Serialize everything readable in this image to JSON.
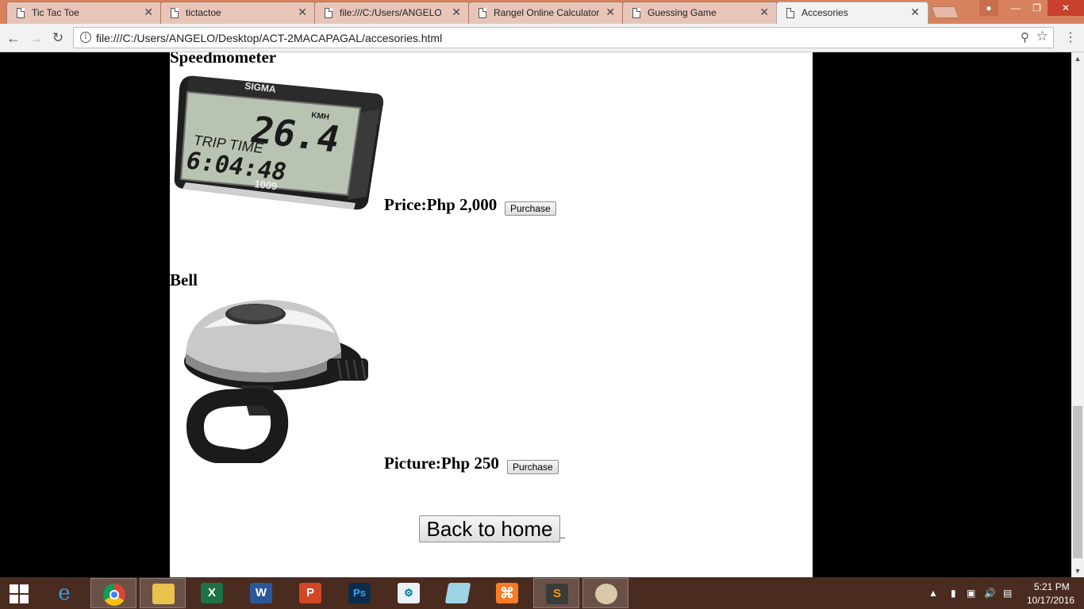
{
  "browser": {
    "tabs": [
      {
        "title": "Tic Tac Toe"
      },
      {
        "title": "tictactoe"
      },
      {
        "title": "file:///C:/Users/ANGELO/"
      },
      {
        "title": "Rangel Online Calculator"
      },
      {
        "title": "Guessing Game"
      },
      {
        "title": "Accesories"
      }
    ],
    "url": "file:///C:/Users/ANGELO/Desktop/ACT-2MACAPAGAL/accesories.html"
  },
  "page": {
    "products": [
      {
        "name": "Speedmometer",
        "price_label": "Price:Php 2,000",
        "button_label": "Purchase",
        "image": "bike-speedometer",
        "display_reading": "26.4",
        "display_unit": "KMH",
        "display_line2": "TRIP TIME",
        "display_line3": "6:04:48",
        "brand": "SIGMA",
        "model": "1009"
      },
      {
        "name": "Bell",
        "price_label": "Picture:Php 250",
        "button_label": "Purchase",
        "image": "bike-bell"
      }
    ],
    "home_button": "Back to home",
    "home_trailing_text": "_"
  },
  "taskbar": {
    "apps": [
      "internet-explorer",
      "chrome",
      "file-explorer",
      "excel",
      "word",
      "powerpoint",
      "photoshop",
      "mysql-installer",
      "notepad",
      "xampp",
      "sublime-text",
      "paint"
    ],
    "time": "5:21 PM",
    "date": "10/17/2016"
  }
}
